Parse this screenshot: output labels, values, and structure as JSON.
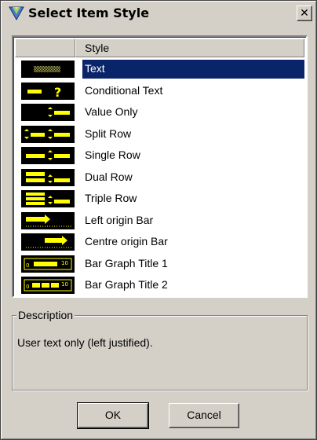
{
  "window": {
    "title": "Select Item Style",
    "close_label": "✕"
  },
  "list": {
    "columns": [
      "",
      "Style"
    ],
    "selected_index": 0,
    "items": [
      {
        "label": "Text",
        "icon": "text-style-icon"
      },
      {
        "label": "Conditional Text",
        "icon": "conditional-text-icon"
      },
      {
        "label": "Value Only",
        "icon": "value-only-icon"
      },
      {
        "label": "Split Row",
        "icon": "split-row-icon"
      },
      {
        "label": "Single Row",
        "icon": "single-row-icon"
      },
      {
        "label": "Dual Row",
        "icon": "dual-row-icon"
      },
      {
        "label": "Triple Row",
        "icon": "triple-row-icon"
      },
      {
        "label": "Left origin Bar",
        "icon": "left-origin-bar-icon"
      },
      {
        "label": "Centre origin Bar",
        "icon": "centre-origin-bar-icon"
      },
      {
        "label": "Bar Graph Title 1",
        "icon": "bar-graph-title-1-icon"
      },
      {
        "label": "Bar Graph Title 2",
        "icon": "bar-graph-title-2-icon"
      }
    ]
  },
  "description": {
    "legend": "Description",
    "text": "User text only (left justified)."
  },
  "buttons": {
    "ok": "OK",
    "cancel": "Cancel"
  },
  "colors": {
    "selection": "#0a246a",
    "swatch_bg": "#000000",
    "swatch_fg": "#ffff00",
    "dialog_bg": "#d4d0c8"
  }
}
